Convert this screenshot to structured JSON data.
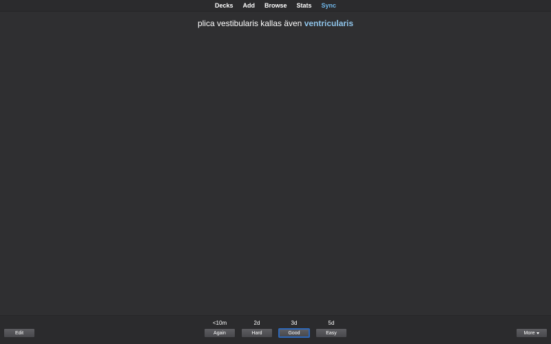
{
  "nav": {
    "decks": "Decks",
    "add": "Add",
    "browse": "Browse",
    "stats": "Stats",
    "sync": "Sync"
  },
  "card": {
    "question_prefix": "plica vestibularis kallas även ",
    "cloze_answer": "ventricularis"
  },
  "bottombar": {
    "edit_label": "Edit",
    "more_label": "More",
    "answers": [
      {
        "interval": "<10m",
        "label": "Again"
      },
      {
        "interval": "2d",
        "label": "Hard"
      },
      {
        "interval": "3d",
        "label": "Good"
      },
      {
        "interval": "5d",
        "label": "Easy"
      }
    ]
  },
  "colors": {
    "background": "#2f2f31",
    "sync_accent": "#6fb6e8",
    "cloze_accent": "#8fc4ea",
    "default_button_border": "#2d67b8"
  }
}
